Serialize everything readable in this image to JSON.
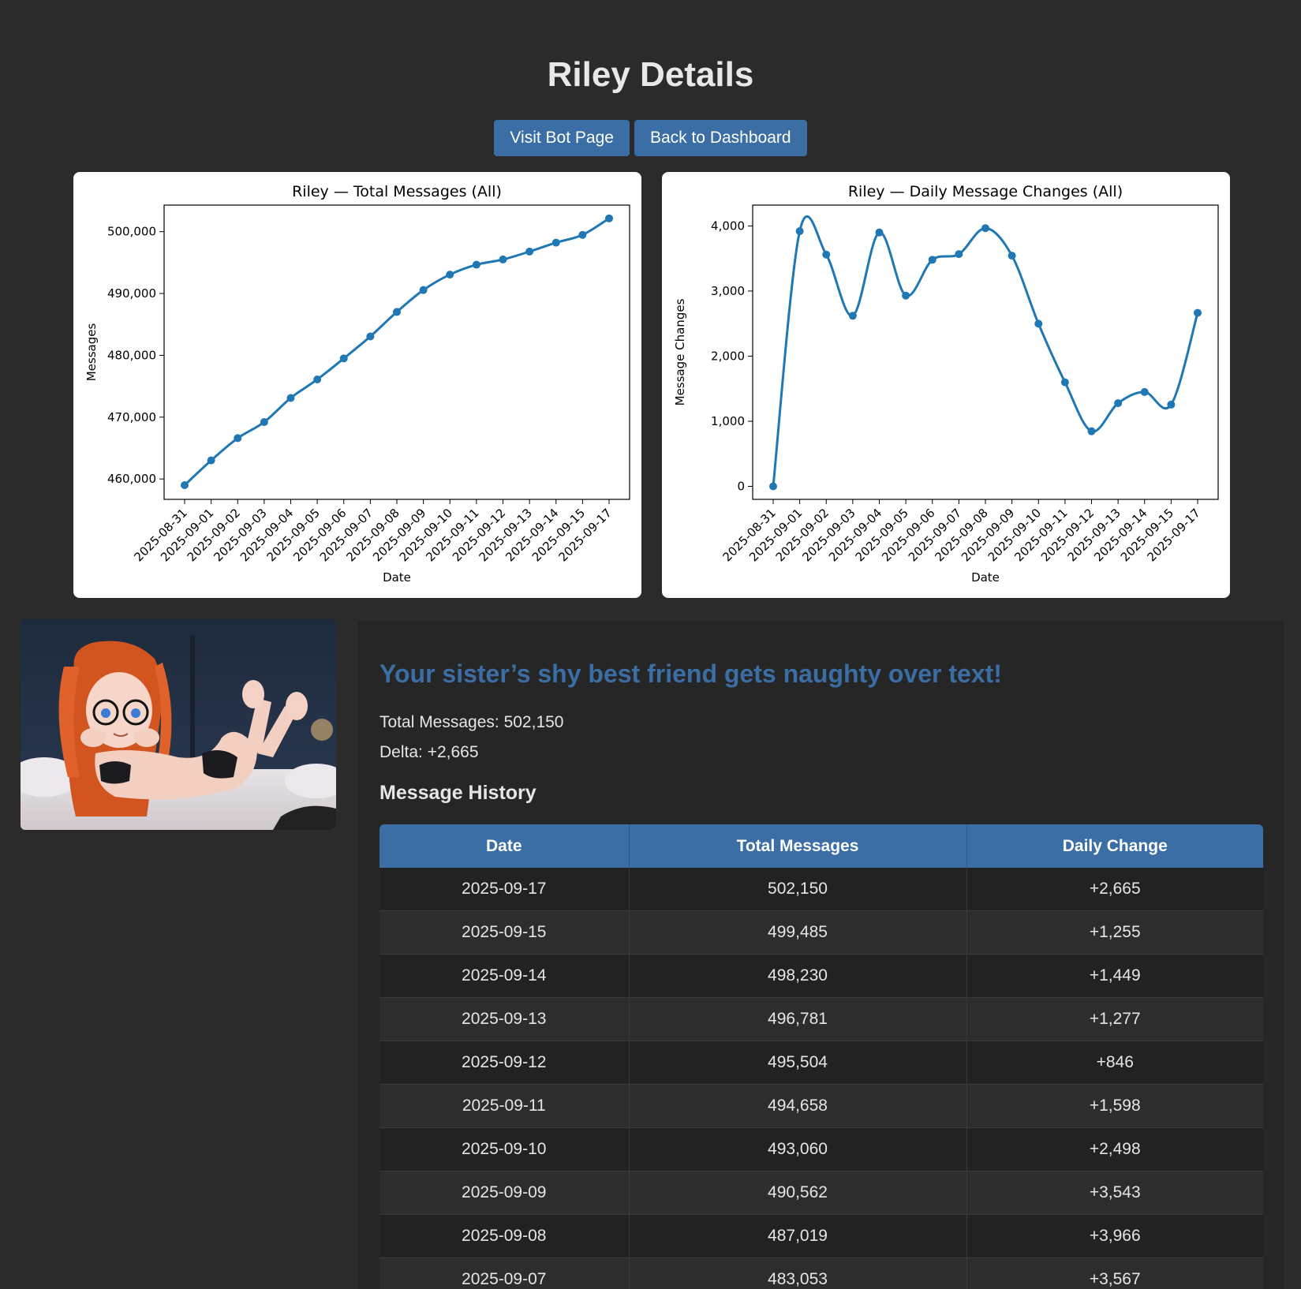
{
  "page": {
    "title": "Riley Details",
    "buttons": {
      "visit": "Visit Bot Page",
      "back": "Back to Dashboard"
    }
  },
  "bot": {
    "tagline": "Your sister’s shy best friend gets naughty over text!",
    "total_messages_label": "Total Messages: 502,150",
    "delta_label": "Delta: +2,665",
    "history_title": "Message History",
    "image_alt": "bot-avatar-illustration"
  },
  "history": {
    "columns": [
      "Date",
      "Total Messages",
      "Daily Change"
    ],
    "rows": [
      [
        "2025-09-17",
        "502,150",
        "+2,665"
      ],
      [
        "2025-09-15",
        "499,485",
        "+1,255"
      ],
      [
        "2025-09-14",
        "498,230",
        "+1,449"
      ],
      [
        "2025-09-13",
        "496,781",
        "+1,277"
      ],
      [
        "2025-09-12",
        "495,504",
        "+846"
      ],
      [
        "2025-09-11",
        "494,658",
        "+1,598"
      ],
      [
        "2025-09-10",
        "493,060",
        "+2,498"
      ],
      [
        "2025-09-09",
        "490,562",
        "+3,543"
      ],
      [
        "2025-09-08",
        "487,019",
        "+3,966"
      ],
      [
        "2025-09-07",
        "483,053",
        "+3,567"
      ],
      [
        "",
        "",
        ""
      ]
    ]
  },
  "colors": {
    "accent": "#3a6ea5",
    "line": "#1f77b4",
    "bg": "#2b2b2b"
  },
  "chart_data": [
    {
      "type": "line",
      "title": "Riley — Total Messages (All)",
      "xlabel": "Date",
      "ylabel": "Messages",
      "x": [
        "2025-08-31",
        "2025-09-01",
        "2025-09-02",
        "2025-09-03",
        "2025-09-04",
        "2025-09-05",
        "2025-09-06",
        "2025-09-07",
        "2025-09-08",
        "2025-09-09",
        "2025-09-10",
        "2025-09-11",
        "2025-09-12",
        "2025-09-13",
        "2025-09-14",
        "2025-09-15",
        "2025-09-17"
      ],
      "values": [
        459000,
        463000,
        466600,
        469200,
        473100,
        476100,
        479500,
        483053,
        487019,
        490562,
        493060,
        494658,
        495504,
        496781,
        498230,
        499485,
        502150
      ],
      "ylim": [
        456700,
        504300
      ],
      "yticks": [
        460000,
        470000,
        480000,
        490000,
        500000
      ],
      "ytick_labels": [
        "460,000",
        "470,000",
        "480,000",
        "490,000",
        "500,000"
      ],
      "grid": false
    },
    {
      "type": "line",
      "title": "Riley — Daily Message Changes (All)",
      "xlabel": "Date",
      "ylabel": "Message Changes",
      "x": [
        "2025-08-31",
        "2025-09-01",
        "2025-09-02",
        "2025-09-03",
        "2025-09-04",
        "2025-09-05",
        "2025-09-06",
        "2025-09-07",
        "2025-09-08",
        "2025-09-09",
        "2025-09-10",
        "2025-09-11",
        "2025-09-12",
        "2025-09-13",
        "2025-09-14",
        "2025-09-15",
        "2025-09-17"
      ],
      "values": [
        0,
        3920,
        3560,
        2620,
        3900,
        2930,
        3480,
        3567,
        3966,
        3543,
        2498,
        1598,
        846,
        1277,
        1449,
        1255,
        2665
      ],
      "ylim": [
        -200,
        4320
      ],
      "yticks": [
        0,
        1000,
        2000,
        3000,
        4000
      ],
      "ytick_labels": [
        "0",
        "1,000",
        "2,000",
        "3,000",
        "4,000"
      ],
      "grid": false
    }
  ]
}
